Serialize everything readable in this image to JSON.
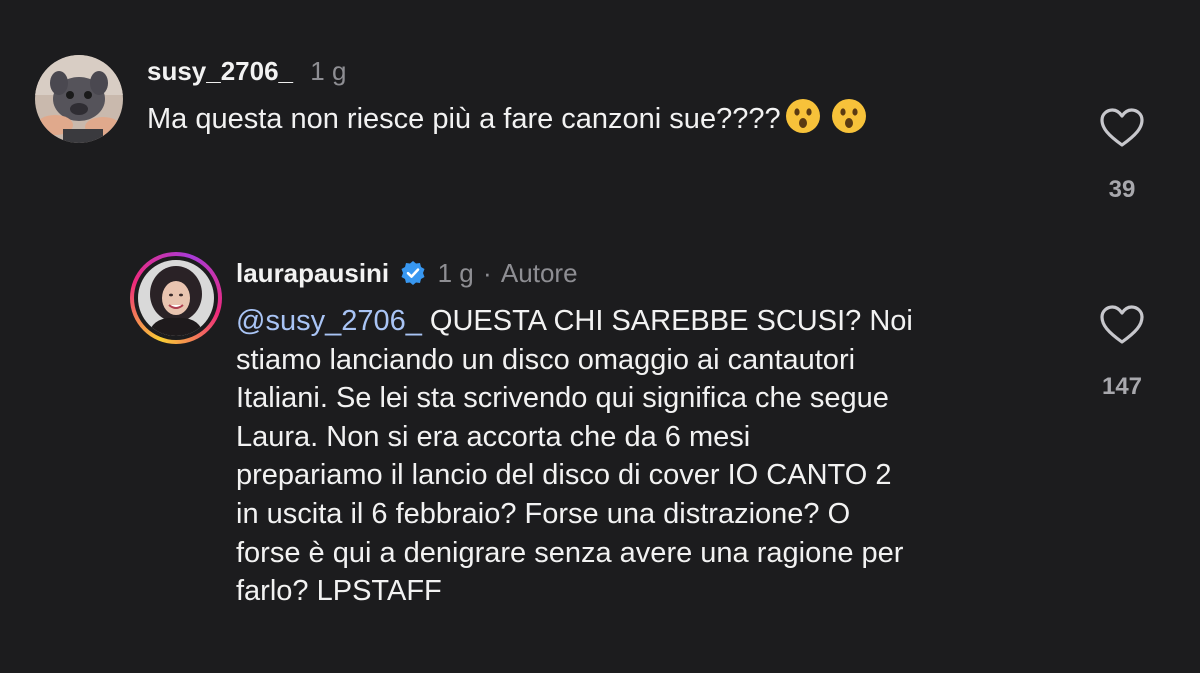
{
  "comment1": {
    "username": "susy_2706_",
    "time": "1 g",
    "text": "Ma questa non riesce più a fare canzoni sue????",
    "emoji_icons": [
      "astonished-face-icon",
      "astonished-face-icon"
    ],
    "like_count": "39",
    "avatar_icon": "puppy-avatar-icon"
  },
  "comment2": {
    "username": "laurapausini",
    "verified_icon": "verified-badge-icon",
    "time": "1 g",
    "separator": "·",
    "role": "Autore",
    "mention": "@susy_2706_",
    "text_lines": [
      " QUESTA CHI SAREBBE SCUSI? Noi",
      "stiamo lanciando un disco omaggio ai cantautori",
      "Italiani. Se lei sta scrivendo qui significa che segue",
      "Laura. Non si era accorta che da 6 mesi",
      "prepariamo il lancio del disco di cover IO CANTO 2",
      "in uscita il 6 febbraio? Forse una distrazione? O",
      "forse è qui a denigrare senza avere una ragione per",
      "farlo? LPSTAFF"
    ],
    "like_count": "147",
    "avatar_icon": "profile-photo-avatar-icon"
  },
  "colors": {
    "background": "#1c1c1e",
    "mention": "#a9c4f5",
    "verified": "#3897f0",
    "meta": "#8e8e93"
  }
}
